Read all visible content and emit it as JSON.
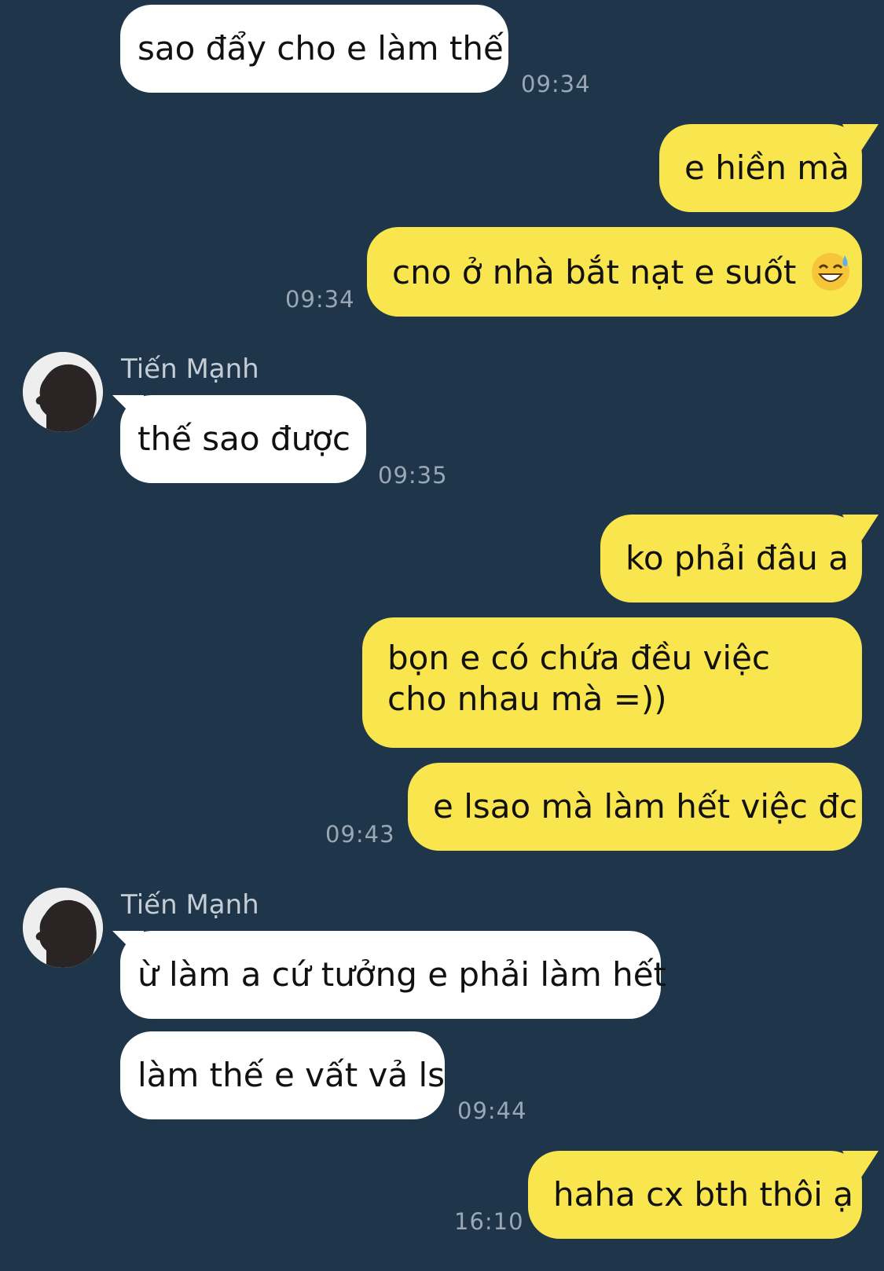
{
  "colors": {
    "background": "#1f354a",
    "incoming_bubble": "#ffffff",
    "outgoing_bubble": "#f9e54e",
    "timestamp": "#9aa7b4"
  },
  "messages": [
    {
      "id": "m1",
      "direction": "incoming",
      "text": "sao đẩy cho e làm thế",
      "time": "09:34"
    },
    {
      "id": "m2",
      "direction": "outgoing",
      "text": "e hiền mà"
    },
    {
      "id": "m3",
      "direction": "outgoing",
      "text": "cno ở nhà bắt nạt e suốt",
      "emoji": "sweat-smile-emoji",
      "time": "09:34"
    },
    {
      "id": "m4",
      "direction": "incoming",
      "sender": "Tiến Mạnh",
      "text": "thế sao được",
      "time": "09:35"
    },
    {
      "id": "m5",
      "direction": "outgoing",
      "text": "ko phải đâu a"
    },
    {
      "id": "m6",
      "direction": "outgoing",
      "text": "bọn e có chứa đều việc cho nhau mà =))"
    },
    {
      "id": "m7",
      "direction": "outgoing",
      "text": "e lsao mà làm hết việc đc",
      "time": "09:43"
    },
    {
      "id": "m8",
      "direction": "incoming",
      "sender": "Tiến Mạnh",
      "text": "ừ làm a cứ tưởng e phải làm hết"
    },
    {
      "id": "m9",
      "direction": "incoming",
      "text": "làm thế e vất vả ls",
      "time": "09:44"
    },
    {
      "id": "m10",
      "direction": "outgoing",
      "text": "haha cx bth thôi ạ",
      "time": "16:10"
    }
  ]
}
